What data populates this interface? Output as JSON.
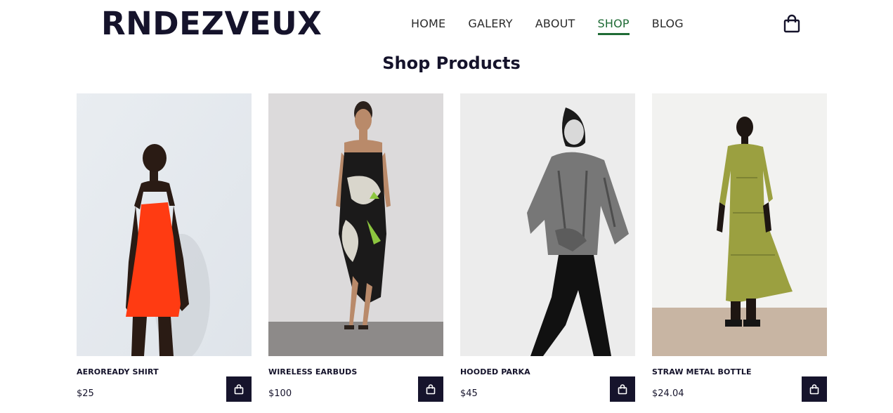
{
  "brand": {
    "name": "RNDEZVEUX"
  },
  "nav": {
    "items": [
      {
        "label": "HOME",
        "active": false
      },
      {
        "label": "GALERY",
        "active": false
      },
      {
        "label": "ABOUT",
        "active": false
      },
      {
        "label": "SHOP",
        "active": true
      },
      {
        "label": "BLOG",
        "active": false
      }
    ],
    "active_color": "#1f6b35",
    "cart_icon": "shopping-bag-icon"
  },
  "page": {
    "title": "Shop Products"
  },
  "products": [
    {
      "name": "AEROREADY SHIRT",
      "price": "$25",
      "image": "model in red mini dress",
      "add_icon": "shopping-bag-icon"
    },
    {
      "name": "WIRELESS EARBUDS",
      "price": "$100",
      "image": "model in black and white printed dress",
      "add_icon": "shopping-bag-icon"
    },
    {
      "name": "HOODED PARKA",
      "price": "$45",
      "image": "model in denim jacket, black and white photo",
      "add_icon": "shopping-bag-icon"
    },
    {
      "name": "STRAW METAL BOTTLE",
      "price": "$24.04",
      "image": "model in green maxi dress",
      "add_icon": "shopping-bag-icon"
    }
  ],
  "colors": {
    "brand_dark": "#16142c",
    "accent_green": "#1f6b35"
  }
}
